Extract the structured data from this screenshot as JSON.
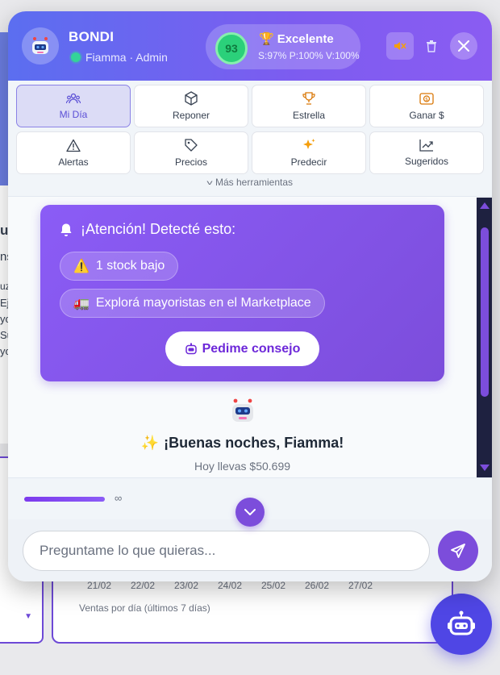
{
  "background": {
    "fragments": [
      "u",
      "ns",
      "uz",
      "Eji",
      "yo",
      "Su",
      "yo"
    ],
    "chart_dates": [
      "21/02",
      "22/02",
      "23/02",
      "24/02",
      "25/02",
      "26/02",
      "27/02"
    ],
    "chart_caption": "Ventas por día (últimos 7 días)"
  },
  "header": {
    "brand": "BONDI",
    "user": "Fiamma · Admin",
    "score": {
      "value": "93",
      "label": "Excelente",
      "stats": "S:97% P:100% V:100%"
    }
  },
  "tools": [
    {
      "label": "Mi Día",
      "icon": "people-icon",
      "active": true
    },
    {
      "label": "Reponer",
      "icon": "box-icon"
    },
    {
      "label": "Estrella",
      "icon": "trophy-icon"
    },
    {
      "label": "Ganar $",
      "icon": "money-icon"
    },
    {
      "label": "Alertas",
      "icon": "warning-icon"
    },
    {
      "label": "Precios",
      "icon": "tag-icon"
    },
    {
      "label": "Predecir",
      "icon": "sparkles-icon"
    },
    {
      "label": "Sugeridos",
      "icon": "trend-icon"
    }
  ],
  "more_tools": "Más herramientas",
  "alert": {
    "title": "¡Atención! Detecté esto:",
    "chips": [
      "1 stock bajo",
      "Explorá mayoristas en el Marketplace"
    ],
    "advice_button": "Pedime consejo"
  },
  "greeting": {
    "text": "¡Buenas noches, Fiamma!",
    "subtext": "Hoy llevas $50.699"
  },
  "limit": {
    "progress": 1.0,
    "value": "∞"
  },
  "composer": {
    "placeholder": "Preguntame lo que quieras..."
  },
  "colors": {
    "accent": "#7c4ddb",
    "header_start": "#5b6ef0",
    "header_end": "#8a5cf2",
    "score_green": "#2bd07a"
  }
}
